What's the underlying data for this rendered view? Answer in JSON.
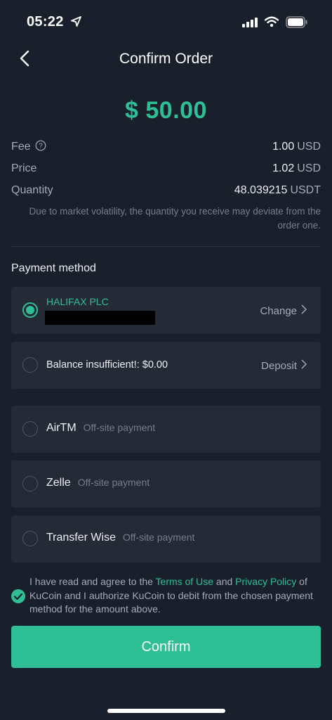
{
  "status_bar": {
    "time": "05:22",
    "icons": [
      "location-arrow-icon",
      "signal-icon",
      "wifi-icon",
      "battery-icon"
    ]
  },
  "header": {
    "title": "Confirm Order",
    "back_icon": "chevron-left-icon"
  },
  "order": {
    "amount": "$ 50.00",
    "fee_label": "Fee",
    "fee_value": "1.00",
    "fee_unit": "USD",
    "price_label": "Price",
    "price_value": "1.02",
    "price_unit": "USD",
    "quantity_label": "Quantity",
    "quantity_value": "48.039215",
    "quantity_unit": "USDT",
    "disclaimer": "Due to market volatility, the quantity you receive may deviate from the order one."
  },
  "payment": {
    "section_title": "Payment method",
    "bank": {
      "name": "HALIFAX PLC",
      "account_masked": "",
      "action": "Change",
      "selected": true
    },
    "balance": {
      "label": "Balance insufficient!: $0.00",
      "action": "Deposit",
      "selected": false
    },
    "options": [
      {
        "name": "AirTM",
        "sub": "Off-site payment",
        "selected": false
      },
      {
        "name": "Zelle",
        "sub": "Off-site payment",
        "selected": false
      },
      {
        "name": "Transfer Wise",
        "sub": "Off-site payment",
        "selected": false
      }
    ]
  },
  "agreement": {
    "checked": true,
    "text_1": "I have read and agree to the ",
    "terms_link": "Terms of Use",
    "text_2": " and ",
    "privacy_link": "Privacy Policy",
    "text_3": " of KuCoin and I authorize KuCoin to debit from the chosen payment method for the amount above."
  },
  "confirm_label": "Confirm",
  "colors": {
    "background": "#1a1f2c",
    "card": "#252a37",
    "accent": "#2fbf94",
    "muted": "#a5abb7"
  }
}
